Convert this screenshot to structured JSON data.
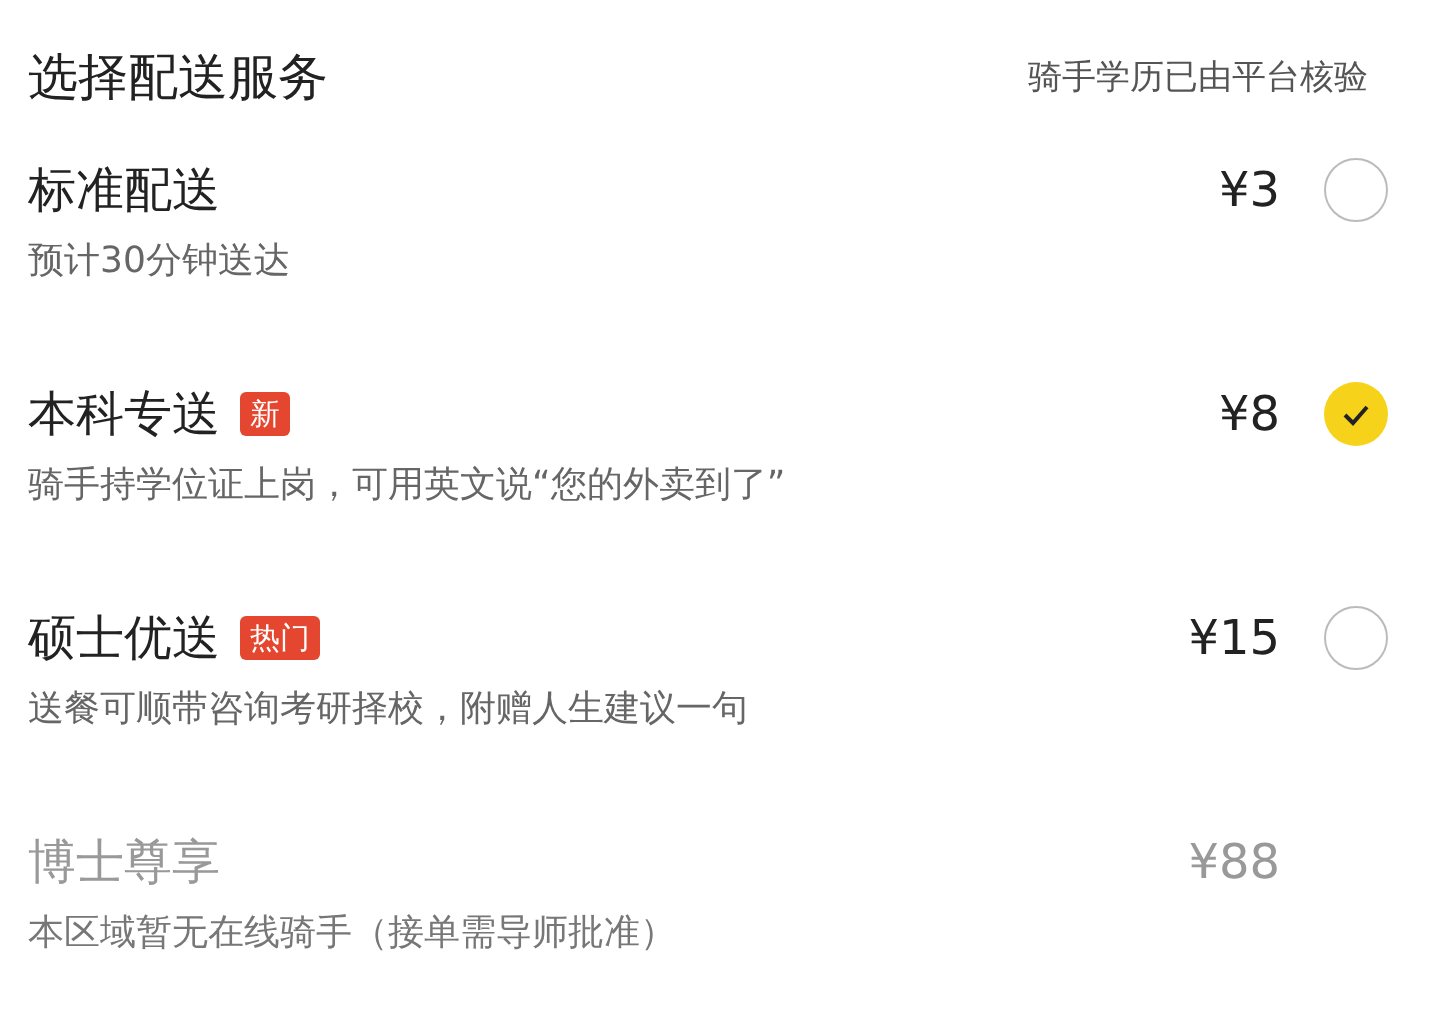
{
  "header": {
    "title": "选择配送服务",
    "note": "骑手学历已由平台核验"
  },
  "options": [
    {
      "name": "标准配送",
      "price": "¥3",
      "description": "预计30分钟送达",
      "selected": false,
      "disabled": false
    },
    {
      "name": "本科专送",
      "badge": "新",
      "price": "¥8",
      "description": "骑手持学位证上岗，可用英文说“您的外卖到了”",
      "selected": true,
      "disabled": false
    },
    {
      "name": "硕士优送",
      "badge": "热门",
      "price": "¥15",
      "description": "送餐可顺带咨询考研择校，附赠人生建议一句",
      "selected": false,
      "disabled": false
    },
    {
      "name": "博士尊享",
      "price": "¥88",
      "description": "本区域暂无在线骑手（接单需导师批准）",
      "disabled": true
    }
  ]
}
